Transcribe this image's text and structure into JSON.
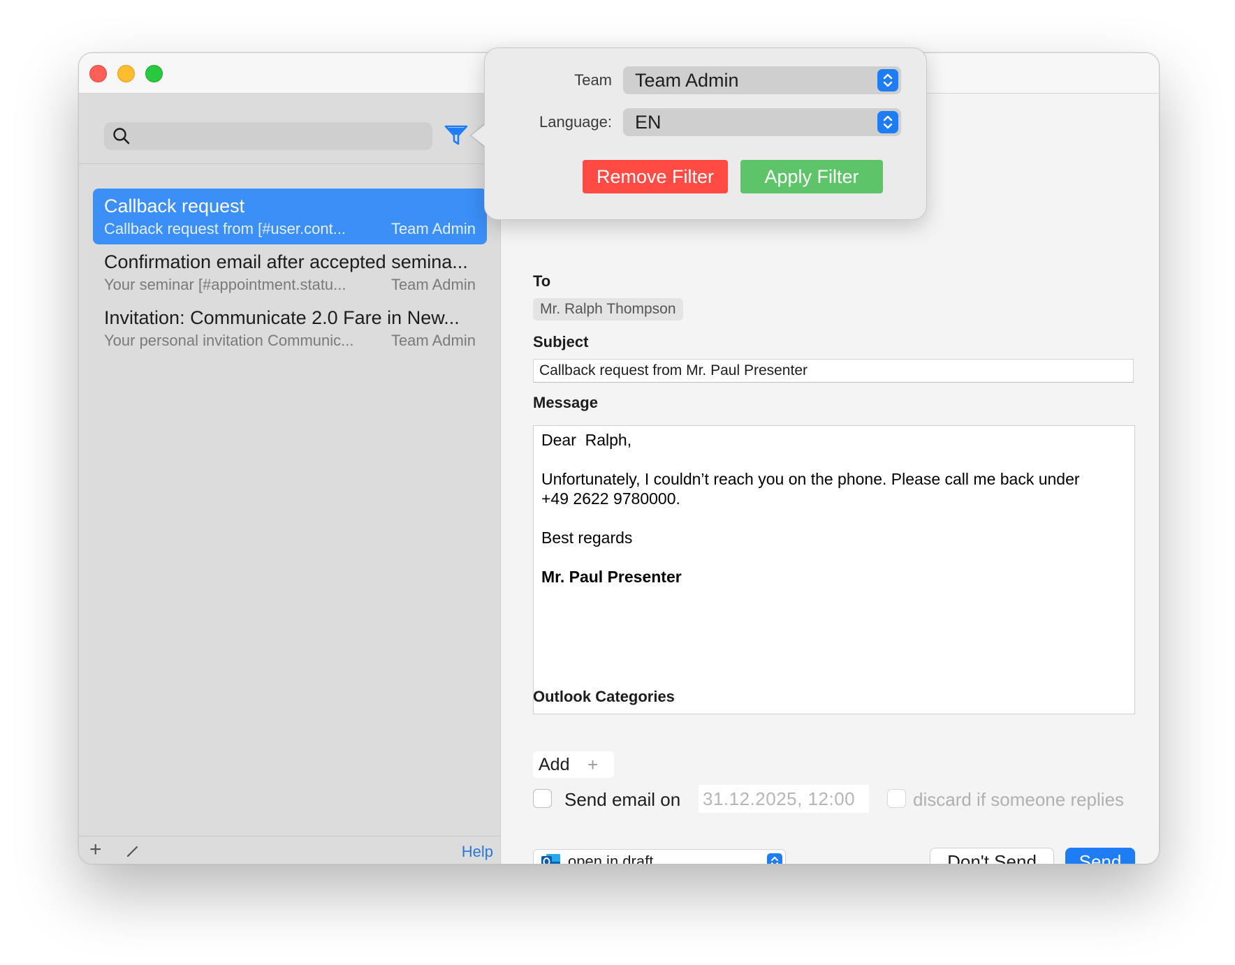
{
  "window": {
    "traffic_lights": [
      "close",
      "minimize",
      "zoom"
    ]
  },
  "sidebar": {
    "search": {
      "placeholder": "",
      "icon": "search-icon"
    },
    "filter_icon": "filter-funnel-icon",
    "templates": [
      {
        "title": "Callback request",
        "preview": "Callback request from [#user.cont...",
        "team": "Team Admin",
        "selected": true
      },
      {
        "title": "Confirmation email after accepted semina...",
        "preview": "Your seminar [#appointment.statu...",
        "team": "Team Admin",
        "selected": false
      },
      {
        "title": "Invitation: Communicate 2.0 Fare in New...",
        "preview": "Your personal invitation Communic...",
        "team": "Team Admin",
        "selected": false
      }
    ],
    "footer": {
      "add_label": "+",
      "help_label": "Help"
    }
  },
  "popover": {
    "team_label": "Team",
    "team_value": "Team Admin",
    "language_label": "Language:",
    "language_value": "EN",
    "remove_filter_label": "Remove Filter",
    "apply_filter_label": "Apply Filter"
  },
  "compose": {
    "to_label": "To",
    "recipient": "Mr. Ralph Thompson",
    "subject_label": "Subject",
    "subject_value": "Callback request from Mr. Paul Presenter",
    "message_label": "Message",
    "message": {
      "greeting": "Dear  Ralph,",
      "body_line1": "Unfortunately, I couldn’t reach you on the phone. Please call me back under",
      "body_line2": "+49 2622 9780000.",
      "closing": "Best regards",
      "signature": "Mr. Paul Presenter"
    },
    "categories_label": "Outlook Categories",
    "add_category_label": "Add",
    "add_category_plus": "+",
    "send_on_label": "Send email on",
    "send_on_checked": false,
    "send_on_datetime": "31.12.2025, 12:00",
    "discard_label": "discard if someone replies",
    "discard_checked": false,
    "draft_option": "open in draft",
    "dont_send_label": "Don't Send",
    "send_label": "Send"
  },
  "colors": {
    "selected_row": "#3b8ff7",
    "accent_blue": "#1e7cf5",
    "remove_red": "#ff4b43",
    "apply_green": "#5ec46a"
  }
}
